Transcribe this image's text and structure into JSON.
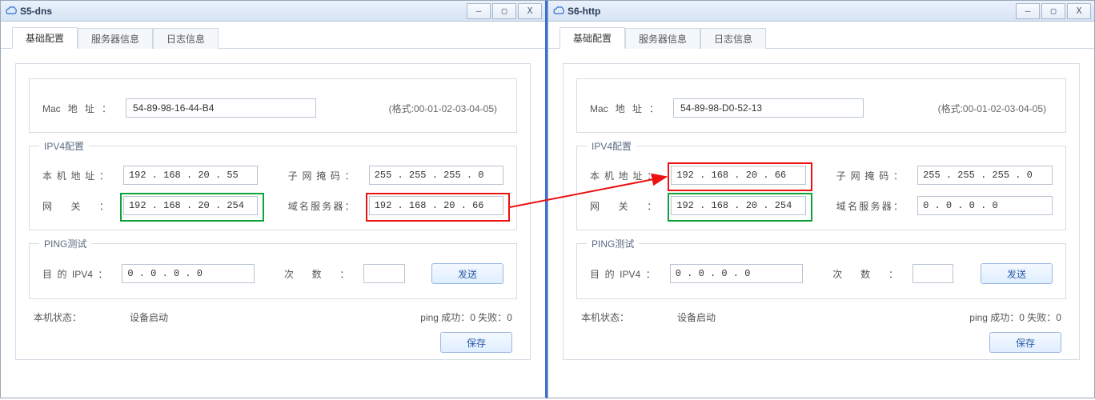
{
  "windows": {
    "left": {
      "title": "S5-dns",
      "tabs": [
        "基础配置",
        "服务器信息",
        "日志信息"
      ],
      "mac": {
        "label": "Mac地址",
        "value": "54-89-98-16-44-B4",
        "hint": "(格式:00-01-02-03-04-05)"
      },
      "ipv4": {
        "title": "IPV4配置",
        "addr_label": "本机地址",
        "addr_value": "192 . 168 .  20 .  55",
        "mask_label": "子网掩码",
        "mask_value": "255 . 255 . 255 .  0",
        "gateway_label": "网关",
        "gateway_value": "192 . 168 .  20 . 254",
        "dns_label": "域名服务器",
        "dns_value": "192 . 168 .  20 .  66"
      },
      "ping": {
        "title": "PING测试",
        "target_label": "目的IPV4",
        "target_value": "0  .  0  .  0  .  0",
        "count_label": "次数",
        "send_label": "发送"
      },
      "status": {
        "host_label": "本机状态：",
        "host_value": "设备启动",
        "ping_text": "ping 成功：0 失败：0"
      },
      "save_label": "保存"
    },
    "right": {
      "title": "S6-http",
      "tabs": [
        "基础配置",
        "服务器信息",
        "日志信息"
      ],
      "mac": {
        "label": "Mac地址",
        "value": "54-89-98-D0-52-13",
        "hint": "(格式:00-01-02-03-04-05)"
      },
      "ipv4": {
        "title": "IPV4配置",
        "addr_label": "本机地址",
        "addr_value": "192 . 168 .  20 .  66",
        "mask_label": "子网掩码",
        "mask_value": "255 . 255 . 255 .  0",
        "gateway_label": "网关",
        "gateway_value": "192 . 168 .  20 . 254",
        "dns_label": "域名服务器",
        "dns_value": "0  .  0  .  0  .  0"
      },
      "ping": {
        "title": "PING测试",
        "target_label": "目的IPV4",
        "target_value": "0  .  0  .  0  .  0",
        "count_label": "次数",
        "send_label": "发送"
      },
      "status": {
        "host_label": "本机状态：",
        "host_value": "设备启动",
        "ping_text": "ping 成功：0 失败：0"
      },
      "save_label": "保存"
    }
  },
  "highlights": {
    "left_gateway_color": "green",
    "left_dns_color": "red",
    "right_addr_color": "red",
    "right_gateway_color": "green"
  },
  "winctrl": {
    "min": "—",
    "max": "▢",
    "close": "X"
  }
}
